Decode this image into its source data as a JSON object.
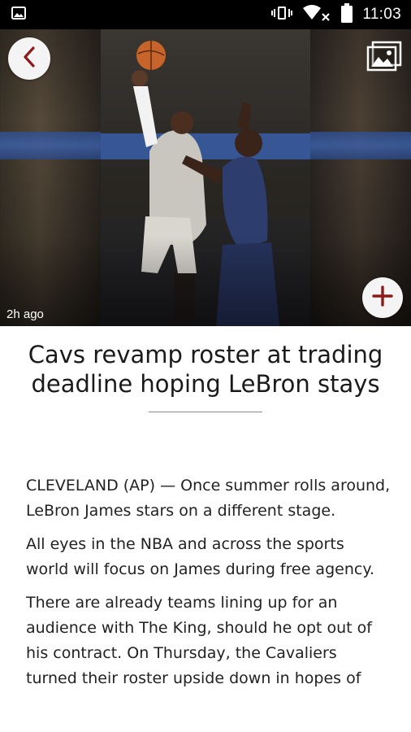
{
  "status_bar": {
    "time": "11:03",
    "icons": [
      "gallery-notification-icon",
      "vibrate-icon",
      "wifi-off-icon",
      "battery-icon"
    ]
  },
  "hero": {
    "timestamp": "2h ago",
    "back_icon": "chevron-left-icon",
    "gallery_icon": "image-gallery-icon",
    "add_icon": "plus-icon",
    "accent_color": "#8b1a1a"
  },
  "article": {
    "headline": "Cavs revamp roster at trading deadline hoping LeBron stays",
    "paragraphs": [
      "CLEVELAND (AP) — Once summer rolls around, LeBron James stars on a different stage.",
      "All eyes in the NBA and across the sports world will focus on James during free agency.",
      "There are already teams lining up for an audience with The King, should he opt out of his contract. On Thursday, the Cavaliers turned their roster upside down in hopes of"
    ]
  }
}
